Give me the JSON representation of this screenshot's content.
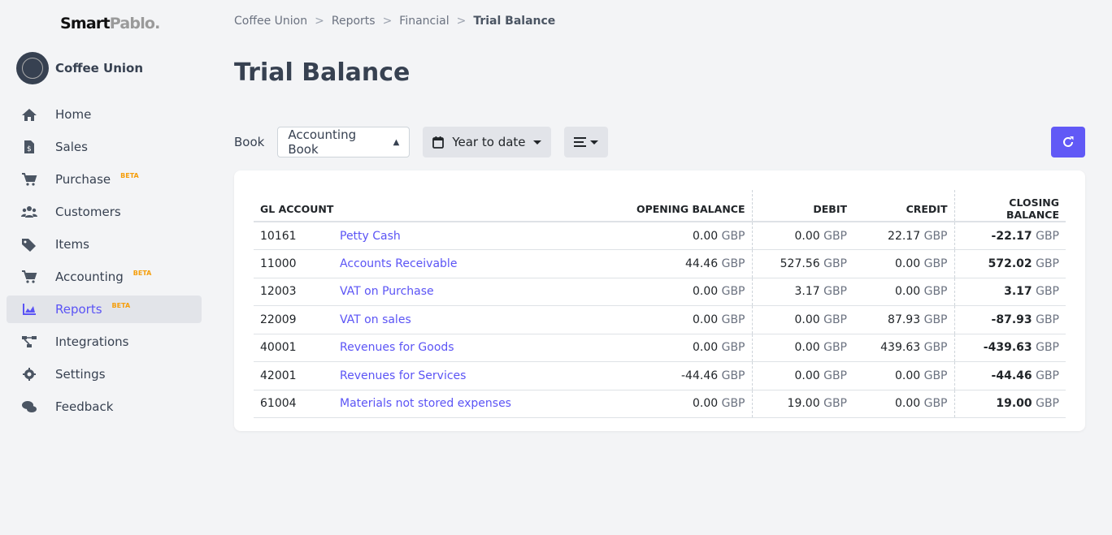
{
  "brand": {
    "part1": "Smart",
    "part2": "Pablo."
  },
  "org": {
    "name": "Coffee Union"
  },
  "sidebar": {
    "items": [
      {
        "label": "Home",
        "icon": "home-icon"
      },
      {
        "label": "Sales",
        "icon": "invoice-icon"
      },
      {
        "label": "Purchase",
        "icon": "cart-icon",
        "badge": "BETA"
      },
      {
        "label": "Customers",
        "icon": "users-icon"
      },
      {
        "label": "Items",
        "icon": "tags-icon"
      },
      {
        "label": "Accounting",
        "icon": "cart-icon",
        "badge": "BETA"
      },
      {
        "label": "Reports",
        "icon": "chart-icon",
        "badge": "BETA",
        "active": true
      },
      {
        "label": "Integrations",
        "icon": "network-icon"
      },
      {
        "label": "Settings",
        "icon": "gear-icon"
      },
      {
        "label": "Feedback",
        "icon": "comments-icon"
      }
    ]
  },
  "breadcrumb": [
    "Coffee Union",
    "Reports",
    "Financial",
    "Trial Balance"
  ],
  "page_title": "Trial Balance",
  "toolbar": {
    "book_label": "Book",
    "book_value": "Accounting Book",
    "period": "Year to date"
  },
  "colors": {
    "accent": "#6159f6",
    "beta": "#f59e0b"
  },
  "table": {
    "headers": [
      "GL ACCOUNT",
      "OPENING BALANCE",
      "DEBIT",
      "CREDIT",
      "CLOSING BALANCE"
    ],
    "currency": "GBP",
    "rows": [
      {
        "code": "10161",
        "name": "Petty Cash",
        "opening": "0.00",
        "debit": "0.00",
        "credit": "22.17",
        "closing": "-22.17"
      },
      {
        "code": "11000",
        "name": "Accounts Receivable",
        "opening": "44.46",
        "debit": "527.56",
        "credit": "0.00",
        "closing": "572.02"
      },
      {
        "code": "12003",
        "name": "VAT on Purchase",
        "opening": "0.00",
        "debit": "3.17",
        "credit": "0.00",
        "closing": "3.17"
      },
      {
        "code": "22009",
        "name": "VAT on sales",
        "opening": "0.00",
        "debit": "0.00",
        "credit": "87.93",
        "closing": "-87.93"
      },
      {
        "code": "40001",
        "name": "Revenues for Goods",
        "opening": "0.00",
        "debit": "0.00",
        "credit": "439.63",
        "closing": "-439.63"
      },
      {
        "code": "42001",
        "name": "Revenues for Services",
        "opening": "-44.46",
        "debit": "0.00",
        "credit": "0.00",
        "closing": "-44.46"
      },
      {
        "code": "61004",
        "name": "Materials not stored expenses",
        "opening": "0.00",
        "debit": "19.00",
        "credit": "0.00",
        "closing": "19.00"
      }
    ]
  }
}
